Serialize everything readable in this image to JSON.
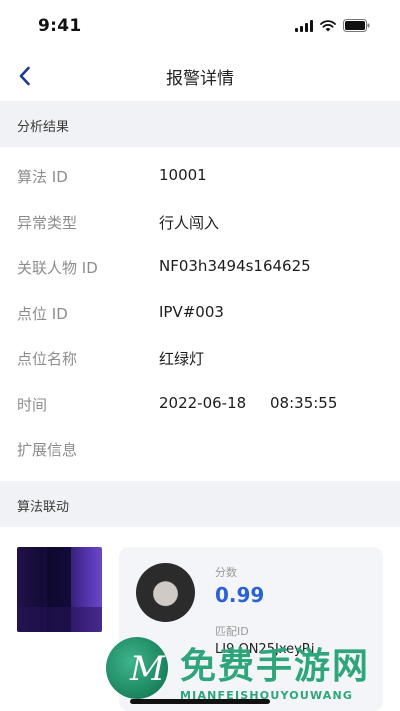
{
  "status_bar": {
    "time": "9:41"
  },
  "header": {
    "title": "报警详情"
  },
  "analysis": {
    "section_title": "分析结果",
    "fields": [
      {
        "label": "算法 ID",
        "value": "10001"
      },
      {
        "label": "异常类型",
        "value": "行人闯入"
      },
      {
        "label": "关联人物 ID",
        "value": "NF03h3494s164625"
      },
      {
        "label": "点位 ID",
        "value": "IPV#003"
      },
      {
        "label": "点位名称",
        "value": "红绿灯"
      },
      {
        "label": "时间",
        "value": "2022-06-18     08:35:55"
      },
      {
        "label": "扩展信息",
        "value": ""
      }
    ]
  },
  "linkage": {
    "section_title": "算法联动",
    "match": {
      "score_label": "分数",
      "score": "0.99",
      "id_label": "匹配ID",
      "id_value": "LI9  ON25JxeyRi"
    }
  },
  "watermark": {
    "cn": "免费手游网",
    "en": "MIANFEISHOUYOUWANG",
    "logo_letter": "M"
  },
  "colors": {
    "accent": "#2a62d4",
    "section_bg": "#f1f2f6",
    "back_icon": "#1e3a8a",
    "watermark": "#2ea57a"
  }
}
